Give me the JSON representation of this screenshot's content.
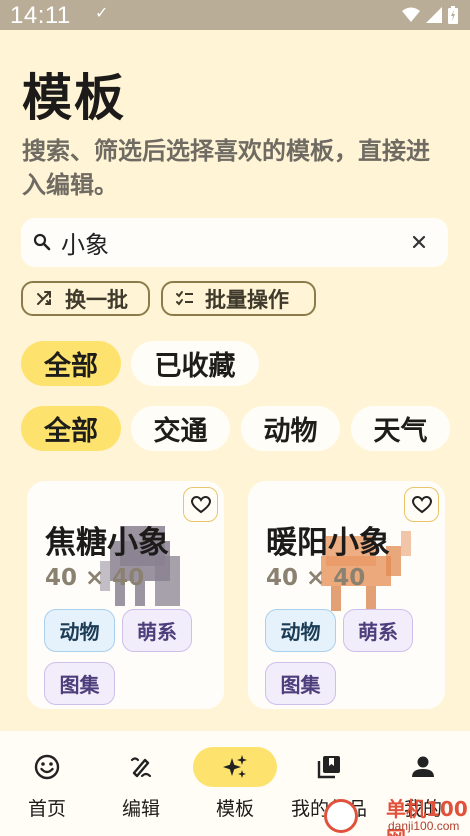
{
  "status_bar": {
    "time": "14:11",
    "check": "✓"
  },
  "page": {
    "title": "模板",
    "description": "搜索、筛选后选择喜欢的模板，直接进入编辑。"
  },
  "search": {
    "value": "小象",
    "placeholder": ""
  },
  "actions": {
    "shuffle_label": "换一批",
    "batch_label": "批量操作"
  },
  "filter_primary": [
    {
      "label": "全部",
      "active": true
    },
    {
      "label": "已收藏",
      "active": false
    }
  ],
  "filter_category": [
    {
      "label": "全部",
      "active": true
    },
    {
      "label": "交通",
      "active": false
    },
    {
      "label": "动物",
      "active": false
    },
    {
      "label": "天气",
      "active": false
    }
  ],
  "cards": [
    {
      "title": "焦糖小象",
      "size": "40 × 40",
      "tags": [
        "动物",
        "萌系",
        "图集"
      ],
      "art_color": "#8a8191"
    },
    {
      "title": "暖阳小象",
      "size": "40 × 40",
      "tags": [
        "动物",
        "萌系",
        "图集"
      ],
      "art_color": "#e99a66"
    }
  ],
  "bottom_nav": [
    {
      "label": "首页",
      "icon": "smile-icon",
      "active": false
    },
    {
      "label": "编辑",
      "icon": "brush-icon",
      "active": false
    },
    {
      "label": "模板",
      "icon": "sparkle-icon",
      "active": true
    },
    {
      "label": "我的作品",
      "icon": "library-icon",
      "active": false
    },
    {
      "label": "我的",
      "icon": "person-icon",
      "active": false
    }
  ],
  "watermark": {
    "text": "单机100网",
    "url": "danji100.com"
  },
  "colors": {
    "accent": "#fde36e",
    "background": "#fff5d6"
  }
}
